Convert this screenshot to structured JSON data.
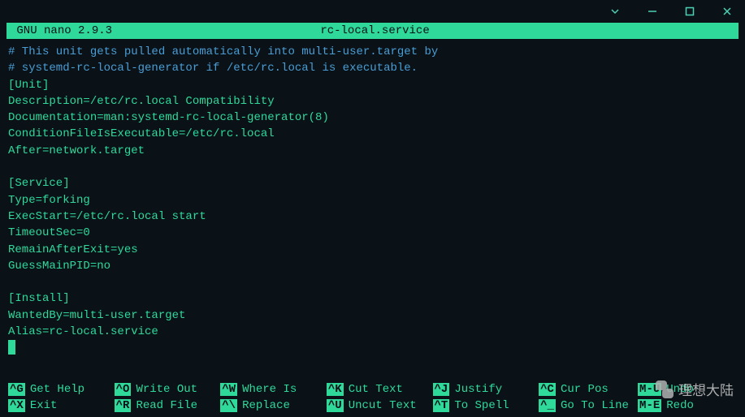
{
  "window": {
    "app_name": "GNU nano",
    "version": "2.9.3",
    "filename": "rc-local.service"
  },
  "content": {
    "lines": [
      {
        "text": "# This unit gets pulled automatically into multi-user.target by",
        "cls": "comment"
      },
      {
        "text": "# systemd-rc-local-generator if /etc/rc.local is executable.",
        "cls": "comment"
      },
      {
        "text": "[Unit]",
        "cls": ""
      },
      {
        "text": "Description=/etc/rc.local Compatibility",
        "cls": ""
      },
      {
        "text": "Documentation=man:systemd-rc-local-generator(8)",
        "cls": ""
      },
      {
        "text": "ConditionFileIsExecutable=/etc/rc.local",
        "cls": ""
      },
      {
        "text": "After=network.target",
        "cls": ""
      },
      {
        "text": "",
        "cls": ""
      },
      {
        "text": "[Service]",
        "cls": ""
      },
      {
        "text": "Type=forking",
        "cls": ""
      },
      {
        "text": "ExecStart=/etc/rc.local start",
        "cls": ""
      },
      {
        "text": "TimeoutSec=0",
        "cls": ""
      },
      {
        "text": "RemainAfterExit=yes",
        "cls": ""
      },
      {
        "text": "GuessMainPID=no",
        "cls": ""
      },
      {
        "text": "",
        "cls": ""
      },
      {
        "text": "[Install]",
        "cls": ""
      },
      {
        "text": "WantedBy=multi-user.target",
        "cls": ""
      },
      {
        "text": "Alias=rc-local.service",
        "cls": ""
      }
    ]
  },
  "shortcuts": {
    "row1": [
      {
        "key": "^G",
        "label": "Get Help"
      },
      {
        "key": "^O",
        "label": "Write Out"
      },
      {
        "key": "^W",
        "label": "Where Is"
      },
      {
        "key": "^K",
        "label": "Cut Text"
      },
      {
        "key": "^J",
        "label": "Justify"
      },
      {
        "key": "^C",
        "label": "Cur Pos"
      },
      {
        "key": "M-U",
        "label": "Undo"
      }
    ],
    "row2": [
      {
        "key": "^X",
        "label": "Exit"
      },
      {
        "key": "^R",
        "label": "Read File"
      },
      {
        "key": "^\\",
        "label": "Replace"
      },
      {
        "key": "^U",
        "label": "Uncut Text"
      },
      {
        "key": "^T",
        "label": "To Spell"
      },
      {
        "key": "^_",
        "label": "Go To Line"
      },
      {
        "key": "M-E",
        "label": "Redo"
      }
    ]
  },
  "watermark": {
    "text": "理想大陆"
  }
}
